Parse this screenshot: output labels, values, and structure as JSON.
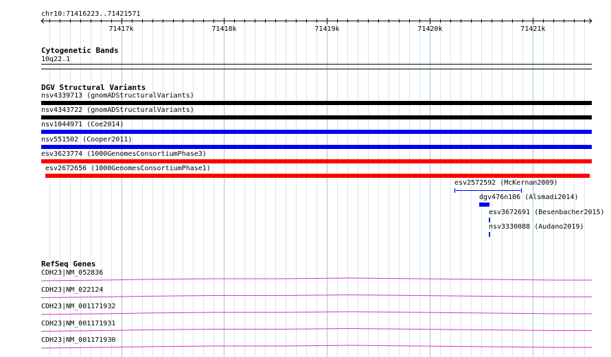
{
  "locus": "chr10:71416223..71421571",
  "ruler": {
    "ticks": [
      {
        "label": "71417k",
        "pos": 71417000
      },
      {
        "label": "71418k",
        "pos": 71418000
      },
      {
        "label": "71419k",
        "pos": 71419000
      },
      {
        "label": "71420k",
        "pos": 71420000
      },
      {
        "label": "71421k",
        "pos": 71421000
      }
    ]
  },
  "tracks": {
    "cytoband": {
      "title": "Cytogenetic Bands",
      "band": "10q22.1"
    },
    "dgv": {
      "title": "DGV Structural Variants",
      "features": [
        {
          "label": "nsv4339713 (gnomADStructuralVariants)",
          "start": 71416223,
          "end": 71421571,
          "color": "#000000"
        },
        {
          "label": "nsv4343722 (gnomADStructuralVariants)",
          "start": 71416223,
          "end": 71421571,
          "color": "#000000"
        },
        {
          "label": "nsv1044971 (Coe2014)",
          "start": 71416223,
          "end": 71421571,
          "color": "#0000ee"
        },
        {
          "label": "nsv551502 (Cooper2011)",
          "start": 71416223,
          "end": 71421571,
          "color": "#0000ee"
        },
        {
          "label": "esv3623774 (1000GenomesConsortiumPhase3)",
          "start": 71416223,
          "end": 71421571,
          "color": "#ff0000"
        },
        {
          "label": "esv2672656 (1000GenomesConsortiumPhase1)",
          "start": 71416260,
          "end": 71421550,
          "color": "#ff0000"
        },
        {
          "label": "esv2572592 (McKernan2009)",
          "start": 71420240,
          "end": 71420890,
          "color": "#0000ee"
        },
        {
          "label": "dgv476n106 (Alsmadi2014)",
          "start": 71420480,
          "end": 71420580,
          "color": "#0000ee"
        },
        {
          "label": "esv3672691 (Besenbacher2015)",
          "start": 71420570,
          "end": 71420582,
          "color": "#0000ee"
        },
        {
          "label": "nsv3330088 (Audano2019)",
          "start": 71420570,
          "end": 71420582,
          "color": "#0000ee"
        }
      ]
    },
    "refseq": {
      "title": "RefSeq Genes",
      "color": "#cc33cc",
      "transcripts": [
        {
          "label": "CDH23|NM_052836"
        },
        {
          "label": "CDH23|NM_022124"
        },
        {
          "label": "CDH23|NM_001171932"
        },
        {
          "label": "CDH23|NM_001171931"
        },
        {
          "label": "CDH23|NM_001171930"
        }
      ]
    }
  }
}
